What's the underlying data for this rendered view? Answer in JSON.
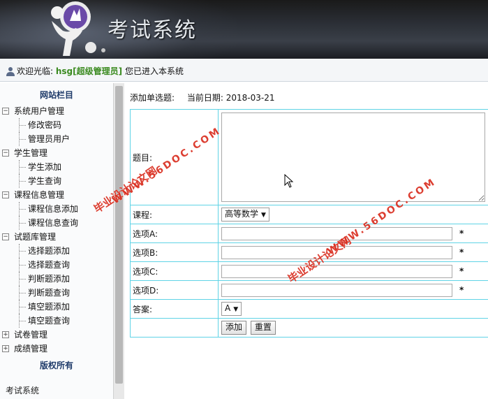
{
  "header": {
    "title": "考试系统"
  },
  "welcome": {
    "prefix": "欢迎光临:",
    "user": "hsg[超级管理员]",
    "suffix": "您已进入本系统"
  },
  "sidebar": {
    "title": "网站栏目",
    "groups": [
      {
        "label": "系统用户管理",
        "expanded": true,
        "items": [
          "修改密码",
          "管理员用户"
        ]
      },
      {
        "label": "学生管理",
        "expanded": true,
        "items": [
          "学生添加",
          "学生查询"
        ]
      },
      {
        "label": "课程信息管理",
        "expanded": true,
        "items": [
          "课程信息添加",
          "课程信息查询"
        ]
      },
      {
        "label": "试题库管理",
        "expanded": true,
        "items": [
          "选择题添加",
          "选择题查询",
          "判断题添加",
          "判断题查询",
          "填空题添加",
          "填空题查询"
        ]
      },
      {
        "label": "试卷管理",
        "expanded": false,
        "items": []
      },
      {
        "label": "成绩管理",
        "expanded": false,
        "items": []
      }
    ],
    "footer": "版权所有",
    "bottom_text": "考试系统"
  },
  "main": {
    "crumb": "添加单选题:",
    "date_label": "当前日期:",
    "date_value": "2018-03-21",
    "form": {
      "question_label": "题目:",
      "question_value": "",
      "course_label": "课程:",
      "course_selected": "高等数学",
      "option_a_label": "选项A:",
      "option_b_label": "选项B:",
      "option_c_label": "选项C:",
      "option_d_label": "选项D:",
      "required_mark": "*",
      "answer_label": "答案:",
      "answer_selected": "A",
      "add_button": "添加",
      "reset_button": "重置"
    }
  },
  "watermarks": {
    "site": "WWW.56DOC.COM",
    "name": "毕业设计论文网"
  },
  "colors": {
    "table_border": "#5fd3e6",
    "user_green": "#3a8a1f",
    "watermark_red": "#d92a1b"
  }
}
